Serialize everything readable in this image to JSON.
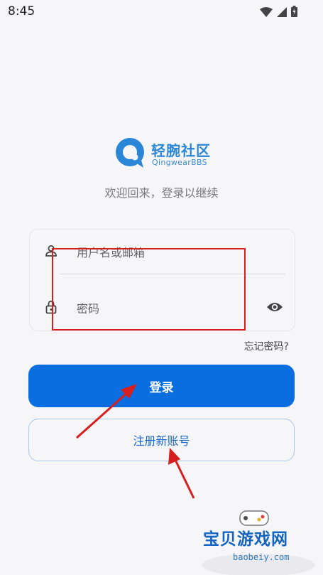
{
  "status_bar": {
    "time": "8:45",
    "icons": [
      "wifi-icon",
      "signal-icon",
      "battery-icon"
    ]
  },
  "app": {
    "logo_name": "轻腕社区",
    "logo_sub": "QingwearBBS",
    "welcome": "欢迎回来，登录以继续"
  },
  "form": {
    "username_placeholder": "用户名或邮箱",
    "password_placeholder": "密码",
    "forgot_label": "忘记密码?"
  },
  "actions": {
    "login_label": "登录",
    "register_label": "注册新账号"
  },
  "watermark": {
    "text": "宝贝游戏网",
    "url": "baobeiy.com"
  },
  "colors": {
    "primary": "#0a6de0",
    "annotation": "#d81f1f",
    "brand": "#2a86d6"
  }
}
